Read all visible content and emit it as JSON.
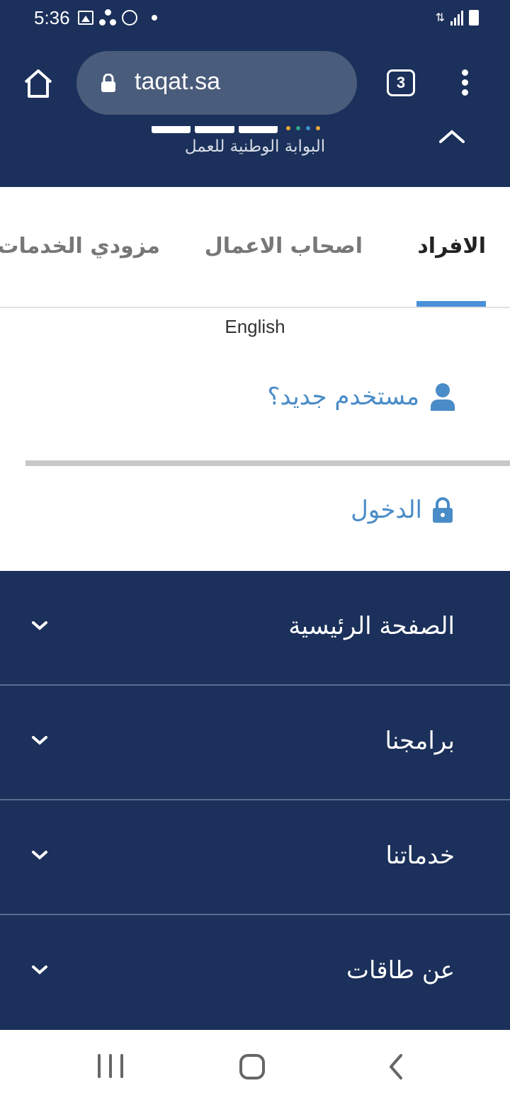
{
  "status_bar": {
    "time": "5:36"
  },
  "browser": {
    "url": "taqat.sa",
    "tab_count": "3"
  },
  "site_header": {
    "logo_tagline": "البوابة الوطنية للعمل"
  },
  "tabs": {
    "individuals": "الافراد",
    "business": "اصحاب الاعمال",
    "providers": "مزودي الخدمات"
  },
  "language_link": "English",
  "account": {
    "new_user": "مستخدم جديد؟",
    "login": "الدخول"
  },
  "nav_menu": {
    "items": [
      {
        "label": "الصفحة الرئيسية"
      },
      {
        "label": "برامجنا"
      },
      {
        "label": "خدماتنا"
      },
      {
        "label": "عن طاقات"
      }
    ]
  },
  "colors": {
    "header_bg": "#1b305a",
    "accent_blue": "#4a8cc7",
    "tab_indicator": "#4a90d9"
  }
}
